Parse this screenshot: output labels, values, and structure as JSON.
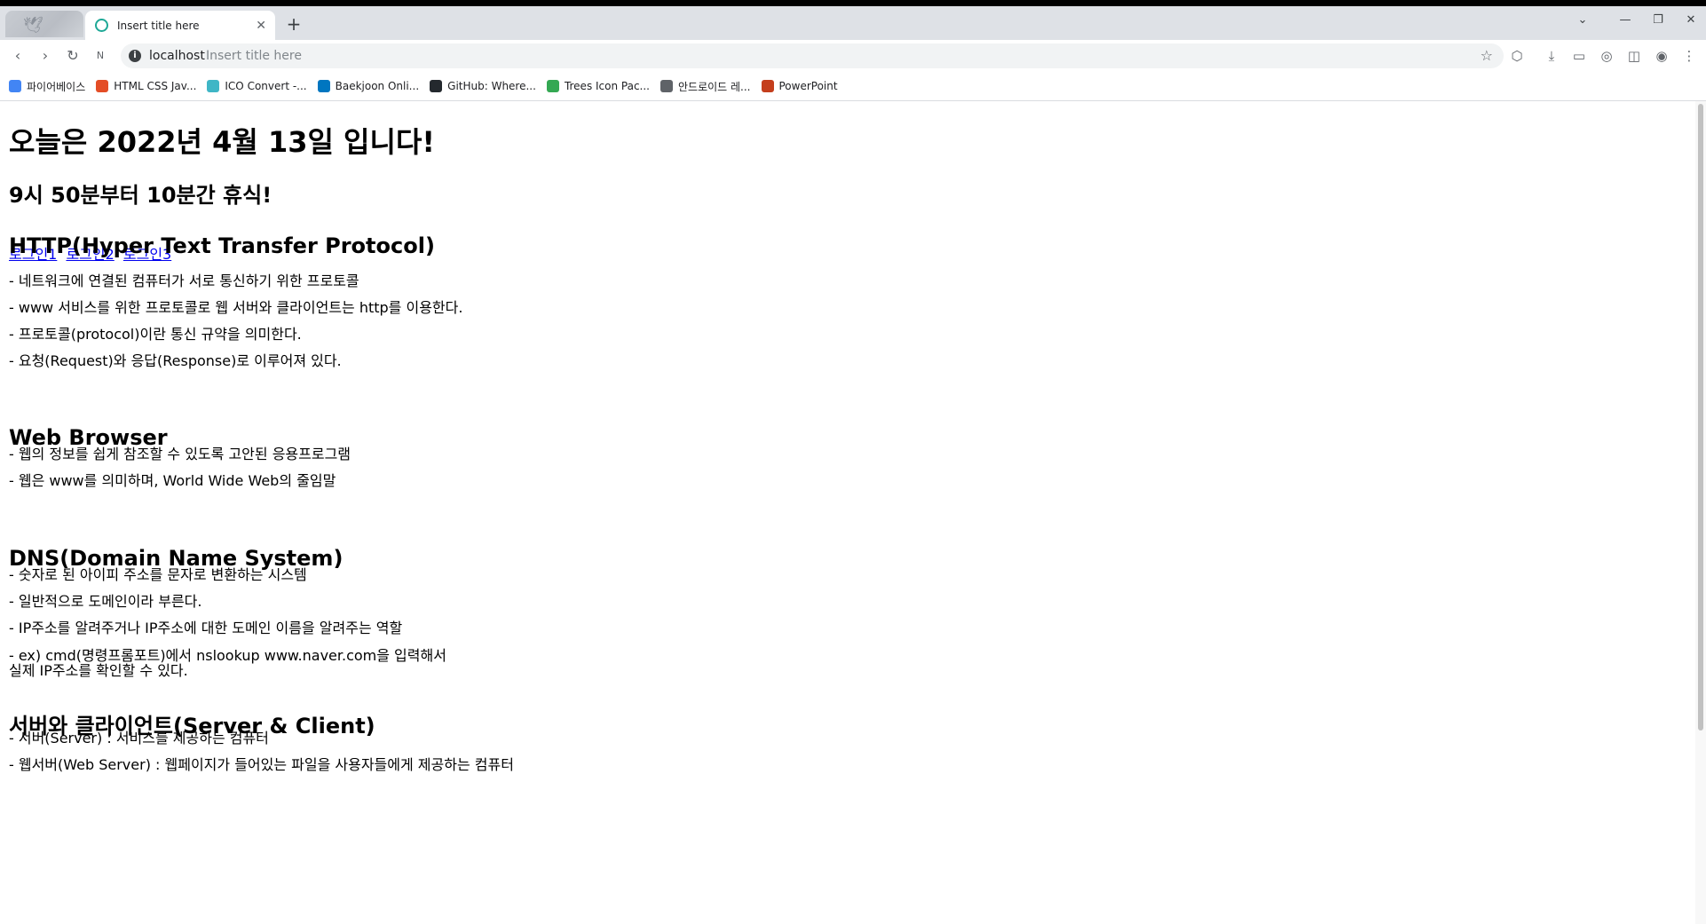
{
  "browser": {
    "tab_title": "Insert title here",
    "address_host": "localhost",
    "address_path": "Insert title here",
    "bookmarks": [
      {
        "label": "파이어베이스",
        "color": "#4285f4"
      },
      {
        "label": "HTML CSS Jav...",
        "color": "#e44d26"
      },
      {
        "label": "ICO Convert -...",
        "color": "#3fb6c6"
      },
      {
        "label": "Baekjoon Onli...",
        "color": "#0076c0"
      },
      {
        "label": "GitHub: Where...",
        "color": "#24292e"
      },
      {
        "label": "Trees Icon Pac...",
        "color": "#34a853"
      },
      {
        "label": "안드로이드 레...",
        "color": "#5f6368"
      },
      {
        "label": "PowerPoint",
        "color": "#c43e1c"
      }
    ]
  },
  "page": {
    "heading": "오늘은 2022년 4월 13일 입니다!",
    "subheading": "9시 50분부터 10분간 휴식!",
    "links": [
      "로그인1",
      "로그인2",
      "로그인3"
    ],
    "sections": [
      {
        "title": "HTTP(Hyper Text Transfer Protocol)",
        "lines": [
          "- 네트워크에 연결된 컴퓨터가 서로 통신하기 위한 프로토콜",
          "- www 서비스를 위한 프로토콜로 웹 서버와 클라이언트는 http를 이용한다.",
          "- 프로토콜(protocol)이란 통신 규약을 의미한다.",
          "- 요청(Request)와 응답(Response)로 이루어져 있다."
        ]
      },
      {
        "title": "Web Browser",
        "lines": [
          "- 웹의 정보를 쉽게 참조할 수 있도록 고안된 응용프로그램",
          "- 웹은 www를 의미하며, World Wide Web의 줄임말"
        ]
      },
      {
        "title": "DNS(Domain Name System)",
        "lines": [
          "- 숫자로 된 아이피 주소를 문자로 변환하는 시스템",
          "- 일반적으로 도메인이라 부른다.",
          "- IP주소를 알려주거나 IP주소에 대한 도메인 이름을 알려주는 역할",
          "- ex) cmd(명령프롬포트)에서 nslookup www.naver.com을 입력해서",
          "실제 IP주소를 확인할 수 있다."
        ]
      },
      {
        "title": "서버와 클라이언트(Server & Client)",
        "lines": [
          "- 서버(Server) : 서비스를 제공하는 컴퓨터",
          "- 웹서버(Web Server) : 웹페이지가 들어있는 파일을 사용자들에게 제공하는 컴퓨터"
        ]
      }
    ]
  }
}
